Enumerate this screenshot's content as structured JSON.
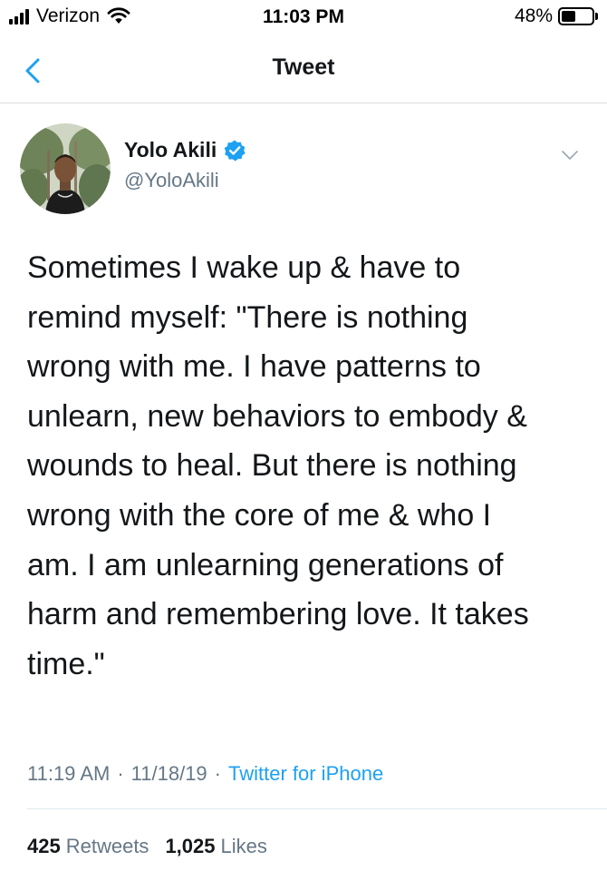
{
  "status_bar": {
    "carrier": "Verizon",
    "time": "11:03 PM",
    "battery_percent": "48%",
    "battery_level": 0.48
  },
  "nav": {
    "title": "Tweet"
  },
  "tweet": {
    "author_name": "Yolo Akili",
    "handle": "@YoloAkili",
    "text": "Sometimes I wake up & have to\nremind myself: \"There is nothing\nwrong with me. I have patterns to\nunlearn, new behaviors to embody &\nwounds to heal. But there is nothing\nwrong with the core of me & who I\nam. I am unlearning generations of\nharm and remembering love. It takes\ntime.\"",
    "time": "11:19 AM",
    "date": "11/18/19",
    "separator": "·",
    "source": "Twitter for iPhone",
    "retweets_count": "425",
    "retweets_label": "Retweets",
    "likes_count": "1,025",
    "likes_label": "Likes"
  },
  "colors": {
    "accent": "#1da1f2",
    "secondary_text": "#657786",
    "primary_text": "#14171a"
  },
  "icons": {
    "back": "chevron-left-icon",
    "verified": "verified-badge-icon",
    "more": "chevron-down-icon",
    "wifi": "wifi-icon",
    "signal": "signal-icon",
    "battery": "battery-icon"
  }
}
